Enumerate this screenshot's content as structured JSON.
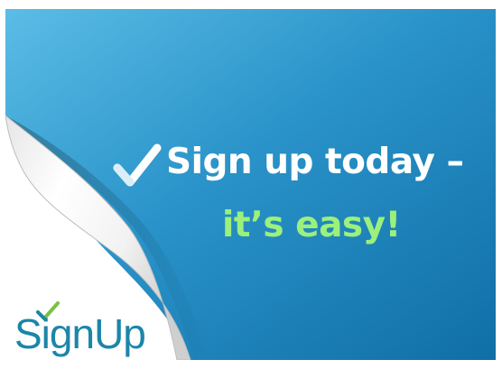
{
  "headline": {
    "line1": "Sign up today –",
    "line2": "it’s easy!"
  },
  "logo": {
    "text": "SignUp"
  },
  "icons": {
    "headline_check": "checkmark-icon",
    "logo_check": "checkmark-icon",
    "page_curl": "page-curl"
  },
  "colors": {
    "background_light": "#5bbde6",
    "background_dark": "#0f6fa6",
    "headline_white": "#ffffff",
    "headline_green": "#9cf07c",
    "logo_teal": "#1b86a8",
    "logo_check_green": "#7ac143"
  }
}
